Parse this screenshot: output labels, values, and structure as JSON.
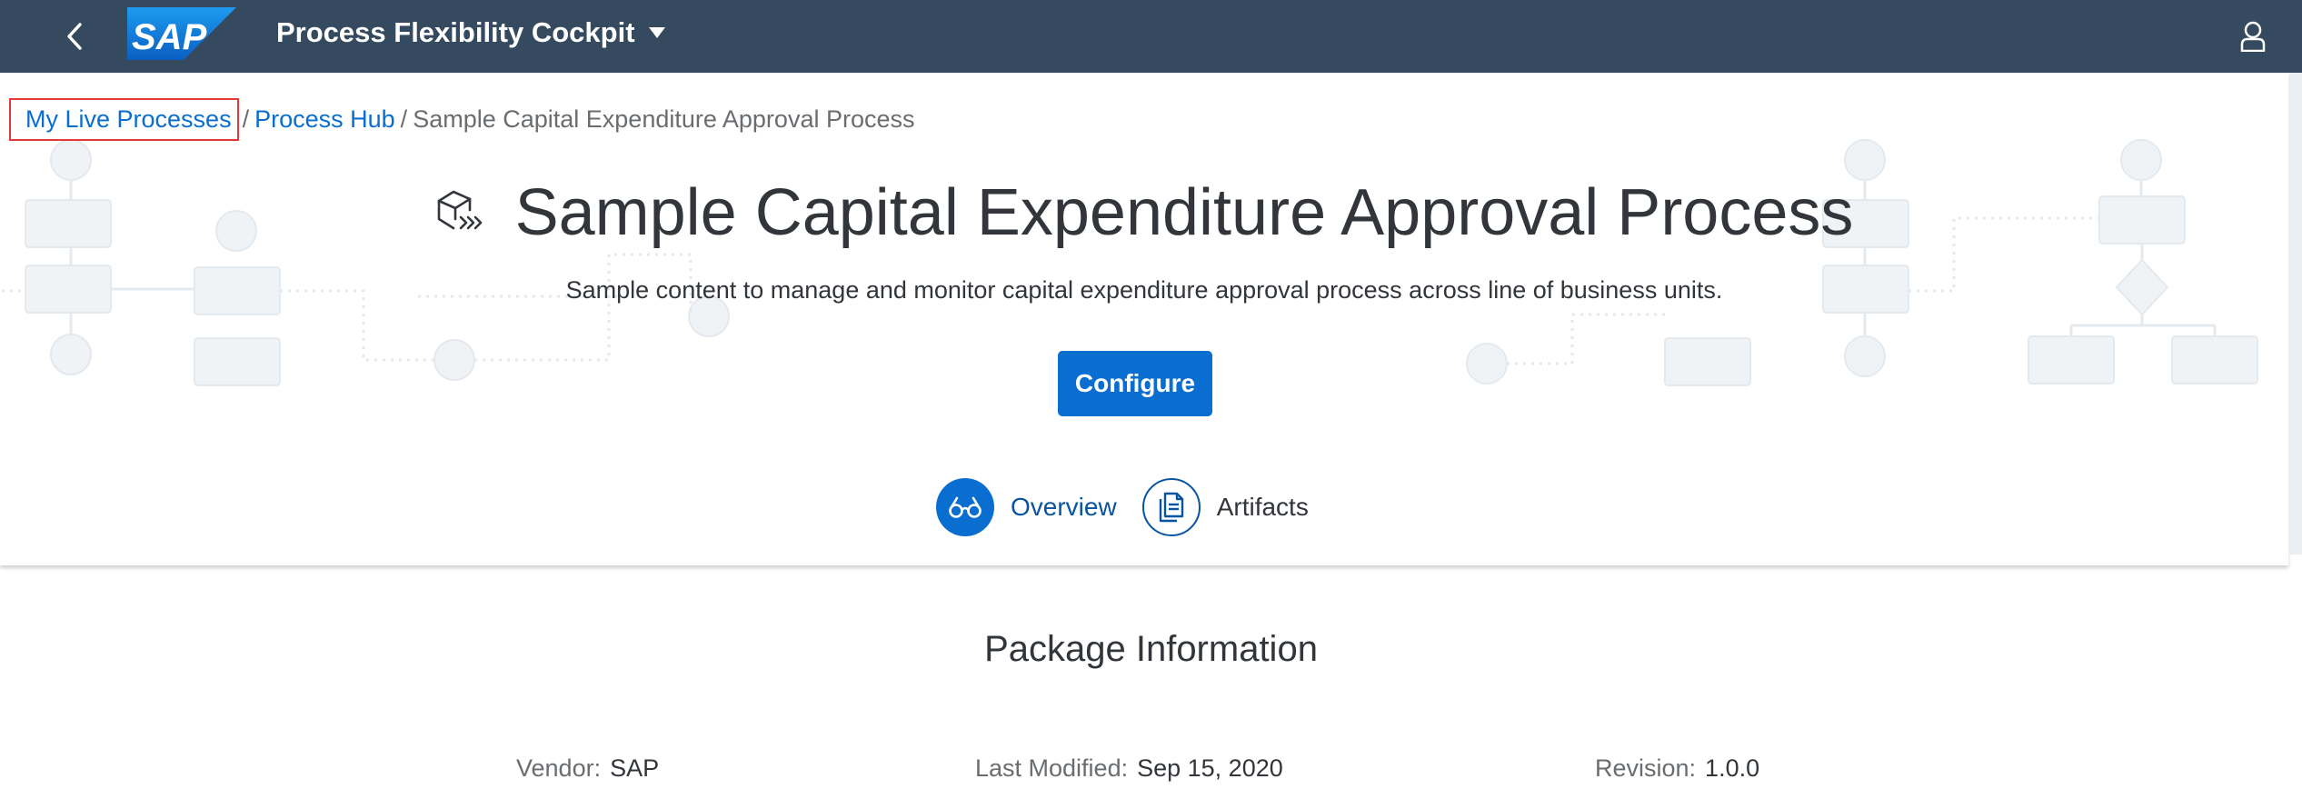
{
  "shell": {
    "app_title": "Process Flexibility Cockpit",
    "logo_text": "SAP",
    "colors": {
      "shell_bg": "#354a5f",
      "accent": "#0a6ed1"
    }
  },
  "breadcrumb": {
    "items": [
      "My Live Processes",
      "Process Hub"
    ],
    "separator": "/",
    "current": "Sample Capital Expenditure Approval Process"
  },
  "header": {
    "title": "Sample Capital Expenditure Approval Process",
    "subtitle": "Sample content to manage and monitor capital expenditure approval process across line of business units.",
    "configure_label": "Configure"
  },
  "tabs": [
    {
      "label": "Overview",
      "icon": "glasses-icon",
      "selected": true
    },
    {
      "label": "Artifacts",
      "icon": "documents-icon",
      "selected": false
    }
  ],
  "package_info": {
    "title": "Package Information",
    "vendor_label": "Vendor:",
    "vendor_value": "SAP",
    "modified_label": "Last Modified:",
    "modified_value": "Sep 15, 2020",
    "revision_label": "Revision:",
    "revision_value": "1.0.0"
  }
}
